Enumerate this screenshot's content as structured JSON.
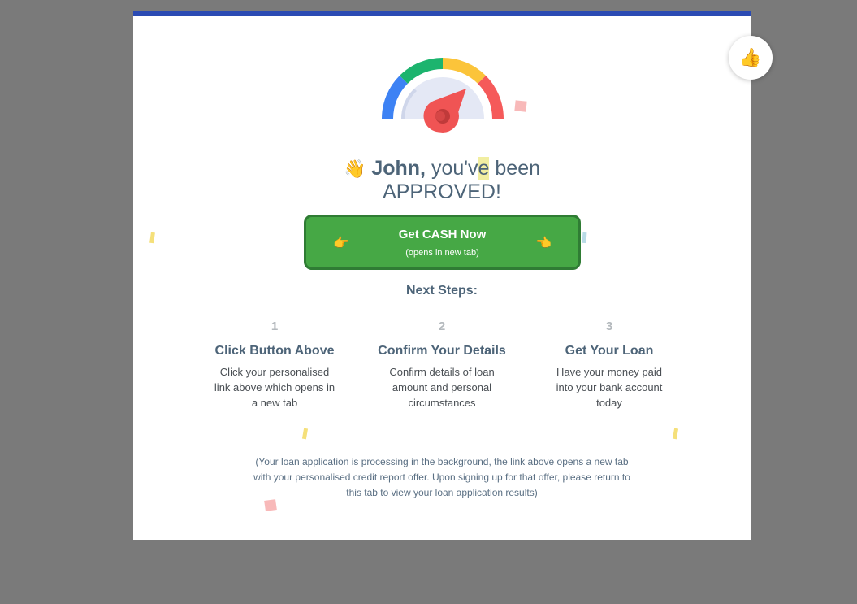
{
  "headline": {
    "wave_emoji": "👋",
    "name": "John,",
    "line1_part1": "you'v",
    "line1_highlight": "e",
    "line1_part2": " been",
    "line2": "APPROVED!"
  },
  "cta": {
    "label": "Get CASH Now",
    "sublabel": "(opens in new tab)",
    "hand_left": "👉",
    "hand_right": "👈",
    "color": "#46a845"
  },
  "next_steps": {
    "title": "Next Steps:",
    "steps": [
      {
        "number": "1",
        "title": "Click Button Above",
        "desc": "Click your personalised link above which opens in a new tab"
      },
      {
        "number": "2",
        "title": "Confirm Your Details",
        "desc": "Confirm details of loan amount and personal circumstances"
      },
      {
        "number": "3",
        "title": "Get Your Loan",
        "desc": "Have your money paid into your bank account today"
      }
    ]
  },
  "disclaimer": "(Your loan application is processing in the background, the link above opens a new tab with your personalised credit report offer. Upon signing up for that offer, please return to this tab to view your loan application results)",
  "feedback_button": {
    "icon": "thumbs-up-icon",
    "glyph": "👍"
  },
  "colors": {
    "accent_bar": "#2b4bb3",
    "heading": "#4d6478",
    "overlay": "#7a7a7a"
  }
}
